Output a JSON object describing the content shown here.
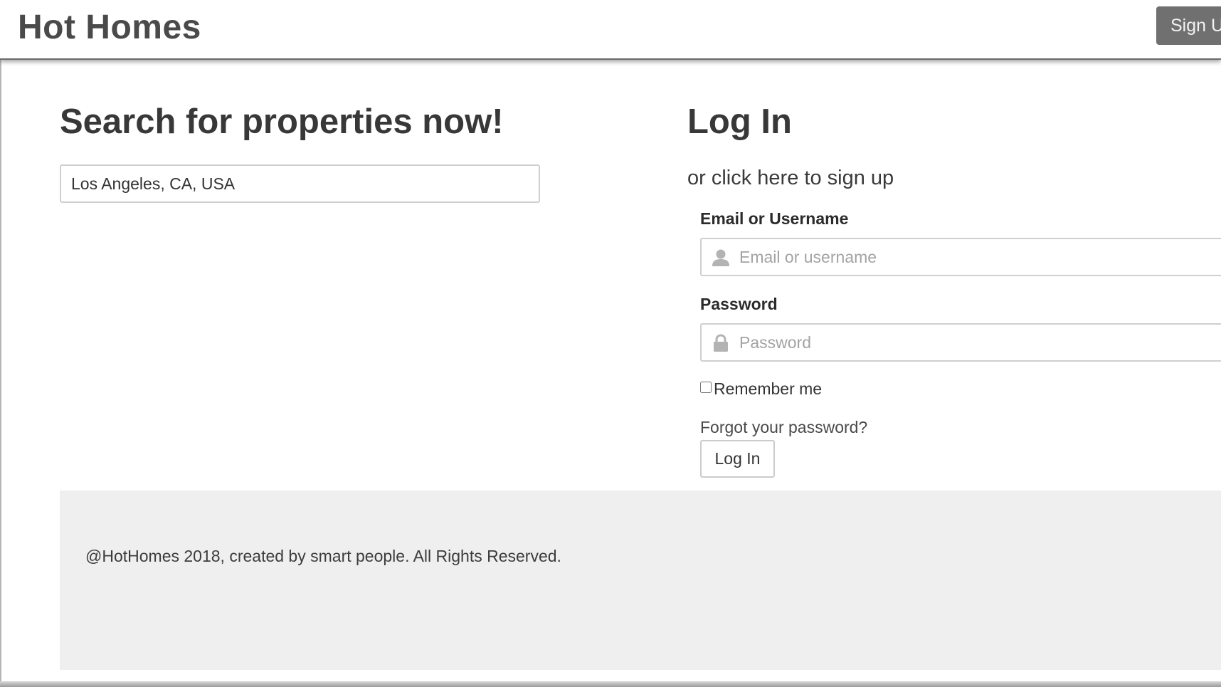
{
  "header": {
    "brand": "Hot Homes",
    "signup_button": "Sign U"
  },
  "search": {
    "title": "Search for properties now!",
    "location_value": "Los Angeles, CA, USA"
  },
  "login": {
    "title": "Log In",
    "signup_link": "or click here to sign up",
    "username_label": "Email or Username",
    "username_placeholder": "Email or username",
    "username_icon": "user-icon",
    "password_label": "Password",
    "password_placeholder": "Password",
    "password_icon": "lock-icon",
    "remember_label": "Remember me",
    "remember_checked": false,
    "forgot_link": "Forgot your password?",
    "submit_label": "Log In"
  },
  "footer": {
    "text": "@HotHomes 2018, created by smart people. All Rights Reserved."
  },
  "colors": {
    "navbar_shadow": "#6b6b6b",
    "signup_button_bg": "#707070",
    "footer_bg": "#efefef",
    "placeholder": "#a3a3a3",
    "icon": "#b3b3b3"
  }
}
